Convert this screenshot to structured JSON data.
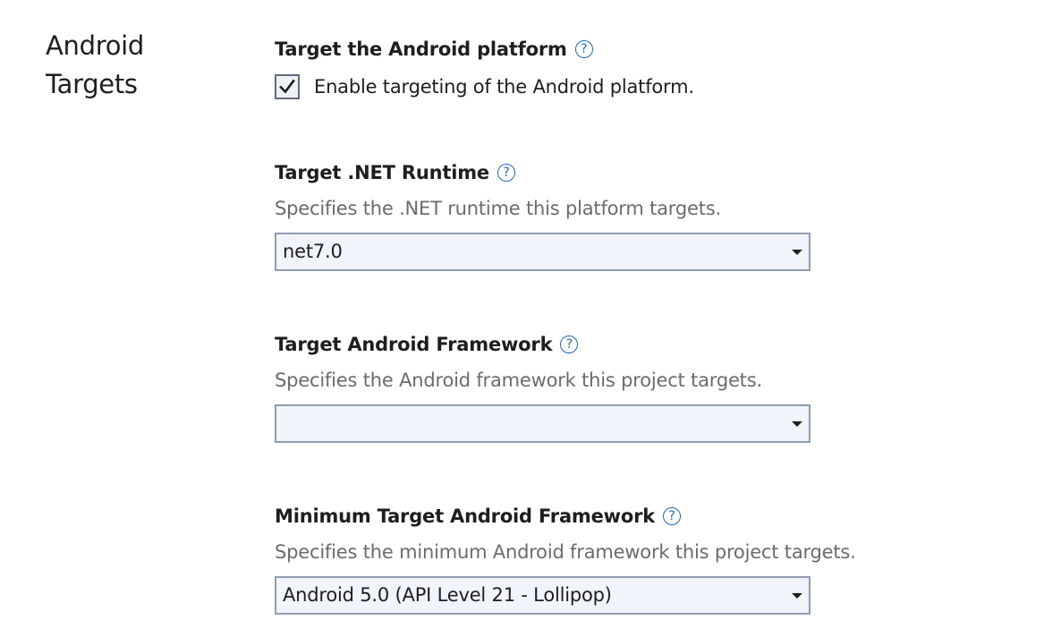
{
  "section": {
    "title_line1": "Android",
    "title_line2": "Targets"
  },
  "platform": {
    "heading": "Target the Android platform",
    "help_icon": "?",
    "checkbox_label": "Enable targeting of the Android platform.",
    "checked": true
  },
  "runtime": {
    "heading": "Target .NET Runtime",
    "help_icon": "?",
    "description": "Specifies the .NET runtime this platform targets.",
    "selected": "net7.0"
  },
  "framework": {
    "heading": "Target Android Framework",
    "help_icon": "?",
    "description": "Specifies the Android framework this project targets.",
    "selected": ""
  },
  "min_framework": {
    "heading": "Minimum Target Android Framework",
    "help_icon": "?",
    "description": "Specifies the minimum Android framework this project targets.",
    "selected": "Android 5.0 (API Level 21 - Lollipop)"
  },
  "colors": {
    "accent": "#1a6ac7",
    "text": "#1e1e1e",
    "muted": "#6b6b6b",
    "input_border": "#8e9db4",
    "input_bg": "#f1f4fb"
  },
  "icons": {
    "help": "help-circle-icon",
    "check": "checkmark-icon",
    "dropdown": "chevron-down-icon"
  }
}
